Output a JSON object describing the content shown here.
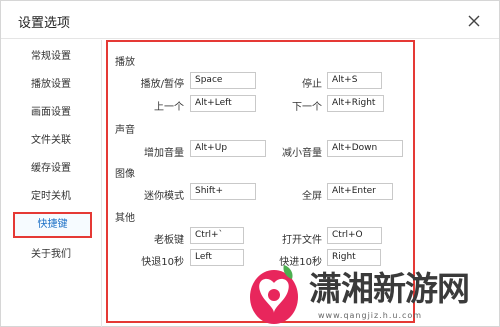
{
  "dialog": {
    "title": "设置选项"
  },
  "sidebar": {
    "items": [
      {
        "label": "常规设置"
      },
      {
        "label": "播放设置"
      },
      {
        "label": "画面设置"
      },
      {
        "label": "文件关联"
      },
      {
        "label": "缓存设置"
      },
      {
        "label": "定时关机"
      },
      {
        "label": "快捷键",
        "active": true
      },
      {
        "label": "关于我们"
      }
    ]
  },
  "hotkeys": {
    "sections": [
      "播放",
      "声音",
      "图像",
      "其他"
    ],
    "items": [
      {
        "label": "播放/暂停",
        "value": "Space"
      },
      {
        "label": "停止",
        "value": "Alt+S"
      },
      {
        "label": "上一个",
        "value": "Alt+Left"
      },
      {
        "label": "下一个",
        "value": "Alt+Right"
      },
      {
        "label": "增加音量",
        "value": "Alt+Up"
      },
      {
        "label": "减小音量",
        "value": "Alt+Down"
      },
      {
        "label": "迷你模式",
        "value": "Shift+"
      },
      {
        "label": "全屏",
        "value": "Alt+Enter"
      },
      {
        "label": "老板键",
        "value": "Ctrl+`"
      },
      {
        "label": "打开文件",
        "value": "Ctrl+O"
      },
      {
        "label": "快退10秒",
        "value": "Left"
      },
      {
        "label": "快进10秒",
        "value": "Right"
      }
    ]
  },
  "watermark": {
    "text": "潇湘新游网",
    "url": "www.qangjiz.h.u.com"
  },
  "colors": {
    "accent_red": "#e53935",
    "active_text": "#1a6fc6"
  },
  "icons": {
    "close": "close-icon"
  }
}
